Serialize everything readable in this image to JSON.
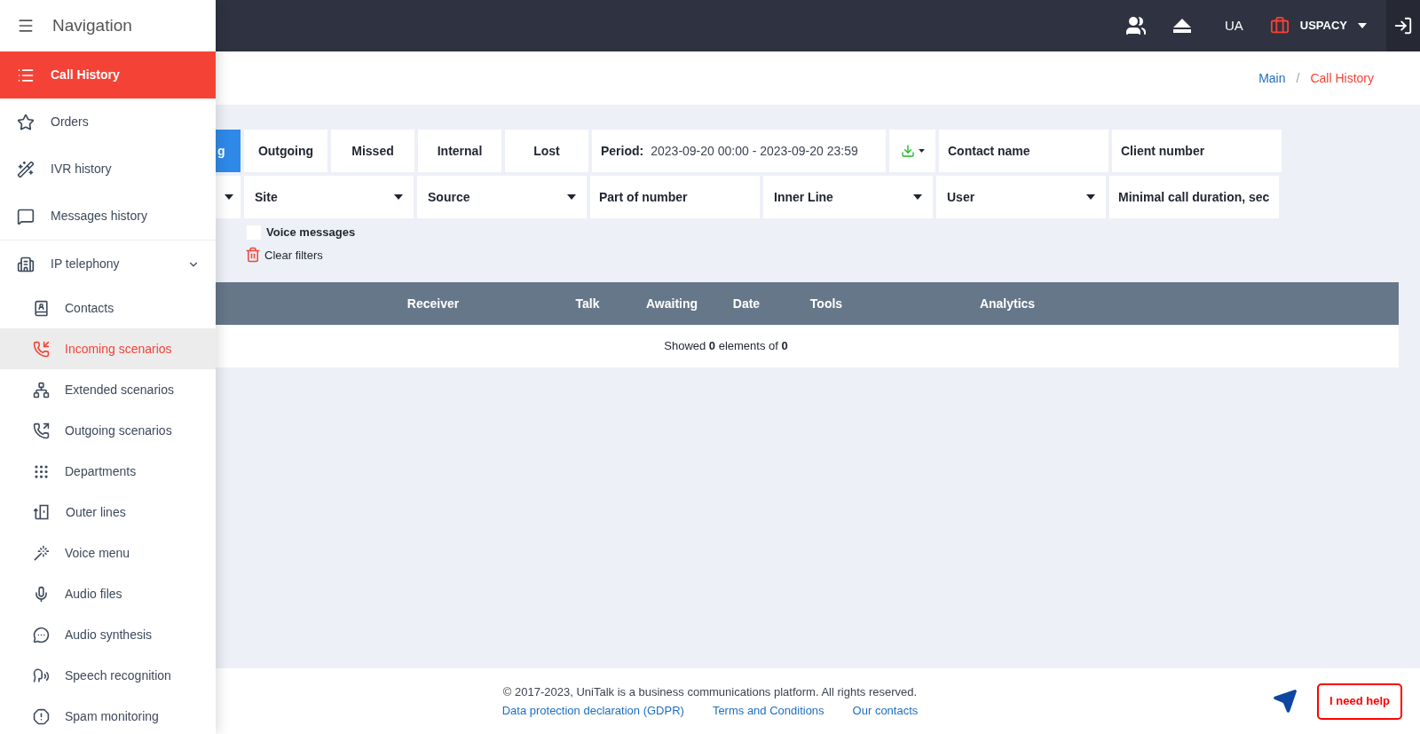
{
  "sidebar": {
    "title": "Navigation",
    "items": [
      {
        "label": "Call History",
        "selected": true
      },
      {
        "label": "Orders",
        "selected": false
      },
      {
        "label": "IVR history",
        "selected": false
      },
      {
        "label": "Messages history",
        "selected": false
      },
      {
        "label": "IP telephony",
        "selected": false,
        "expanded": true,
        "children": [
          {
            "label": "Contacts",
            "selected": false
          },
          {
            "label": "Incoming scenarios",
            "selected": true
          },
          {
            "label": "Extended scenarios",
            "selected": false
          },
          {
            "label": "Outgoing scenarios",
            "selected": false
          },
          {
            "label": "Departments",
            "selected": false
          },
          {
            "label": "Outer lines",
            "selected": false
          },
          {
            "label": "Voice menu",
            "selected": false
          },
          {
            "label": "Audio files",
            "selected": false
          },
          {
            "label": "Audio synthesis",
            "selected": false
          },
          {
            "label": "Speech recognition",
            "selected": false
          },
          {
            "label": "Spam monitoring",
            "selected": false
          }
        ]
      }
    ]
  },
  "topbar": {
    "language": "UA",
    "account": "USPACY"
  },
  "breadcrumb": {
    "separator": "/",
    "items": [
      {
        "label": "Main",
        "current": false
      },
      {
        "label": "Call History",
        "current": true
      }
    ]
  },
  "filters": {
    "tabs": [
      {
        "label": "g",
        "selected": true
      },
      {
        "label": "Outgoing",
        "selected": false
      },
      {
        "label": "Missed",
        "selected": false
      },
      {
        "label": "Internal",
        "selected": false
      },
      {
        "label": "Lost",
        "selected": false
      }
    ],
    "period": {
      "label": "Period:",
      "value": "2023-09-20 00:00 - 2023-09-20 23:59"
    },
    "row1_fields": [
      {
        "placeholder": "Contact name"
      },
      {
        "placeholder": "Client number"
      }
    ],
    "row2_fields": [
      {
        "kind": "select"
      },
      {
        "kind": "select",
        "label": "Site"
      },
      {
        "kind": "select",
        "label": "Source"
      },
      {
        "kind": "input",
        "placeholder": "Part of number"
      },
      {
        "kind": "select",
        "label": "Inner Line"
      },
      {
        "kind": "select",
        "label": "User"
      },
      {
        "kind": "input",
        "placeholder": "Minimal call duration, sec"
      }
    ],
    "voice_messages": {
      "label": "Voice messages",
      "checked": false
    },
    "clear_filters": "Clear filters"
  },
  "table": {
    "columns": [
      "Receiver",
      "Talk",
      "Awaiting",
      "Date",
      "Tools",
      "Analytics"
    ],
    "summary": "Showed **0** elements of **0**"
  },
  "footer": {
    "copyright": "© 2017-2023, UniTalk is a business communications platform. All rights reserved.",
    "links": [
      "Data protection declaration (GDPR)",
      "Terms and Conditions",
      "Our contacts"
    ],
    "help_button": "I need help"
  }
}
